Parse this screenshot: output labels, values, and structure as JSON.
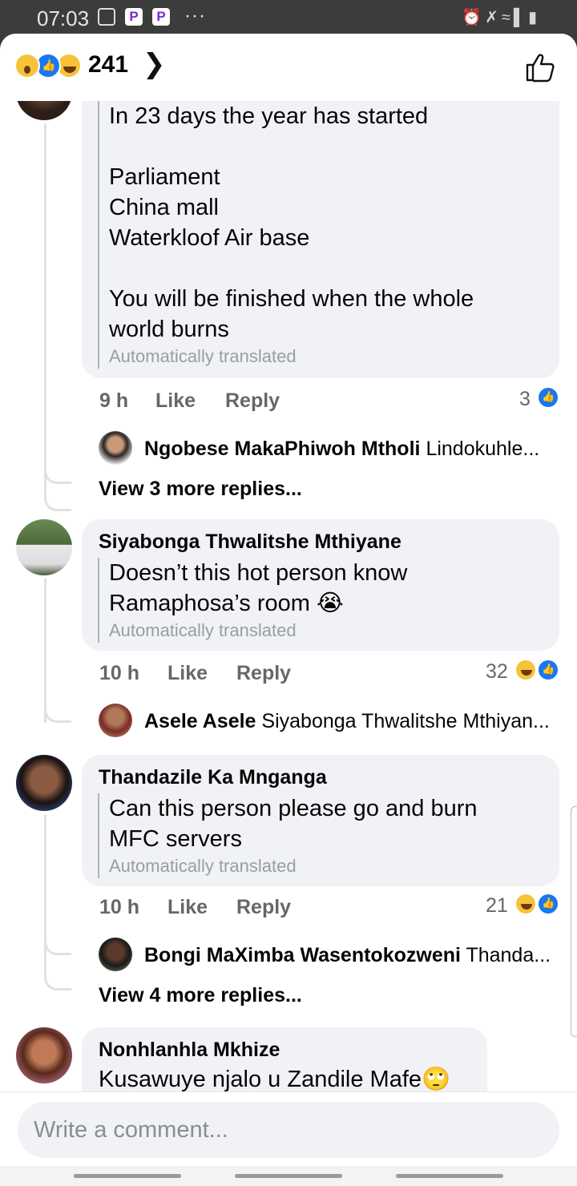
{
  "status_bar": {
    "time": "07:03",
    "app_badge": "P"
  },
  "header": {
    "reaction_count": "241"
  },
  "comments": [
    {
      "lines": [
        "In 23 days the year has started",
        "",
        "Parliament",
        "China mall",
        "Waterkloof Air base",
        "",
        "You will be finished when the whole",
        "world burns"
      ],
      "translated_note": "Automatically translated",
      "time": "9 h",
      "like_label": "Like",
      "reply_label": "Reply",
      "reaction_count": "3",
      "reply_preview": {
        "name": "Ngobese MakaPhiwoh Mtholi",
        "text": "Lindokuhle..."
      },
      "more_replies": "View 3 more replies..."
    },
    {
      "name": "Siyabonga Thwalitshe Mthiyane",
      "lines": [
        "Doesn’t this hot person know",
        "Ramaphosa’s room 😭"
      ],
      "translated_note": "Automatically translated",
      "time": "10 h",
      "like_label": "Like",
      "reply_label": "Reply",
      "reaction_count": "32",
      "reply_preview": {
        "name": "Asele Asele",
        "text": "Siyabonga Thwalitshe Mthiyan..."
      }
    },
    {
      "name": "Thandazile Ka Mnganga",
      "lines": [
        "Can this person please go and burn",
        "MFC servers"
      ],
      "translated_note": "Automatically translated",
      "time": "10 h",
      "like_label": "Like",
      "reply_label": "Reply",
      "reaction_count": "21",
      "reply_preview": {
        "name": "Bongi MaXimba Wasentokozweni",
        "text": "Thanda..."
      },
      "more_replies": "View 4 more replies..."
    },
    {
      "name": "Nonhlanhla Mkhize",
      "lines": [
        "Kusawuye njalo u Zandile Mafe🙄"
      ]
    }
  ],
  "composer": {
    "placeholder": "Write a comment..."
  },
  "colors": {
    "accent": "#1877f2",
    "bubble": "#f0f2f5",
    "meta_text": "#65676b"
  },
  "icons": [
    "gallery-icon",
    "p-app-icon",
    "more-dots-icon",
    "alarm-icon",
    "mute-icon",
    "wifi-icon",
    "signal-icon",
    "battery-icon",
    "wow-reaction-icon",
    "like-reaction-icon",
    "haha-reaction-icon",
    "chevron-right-icon",
    "like-thumb-icon",
    "avatar"
  ]
}
